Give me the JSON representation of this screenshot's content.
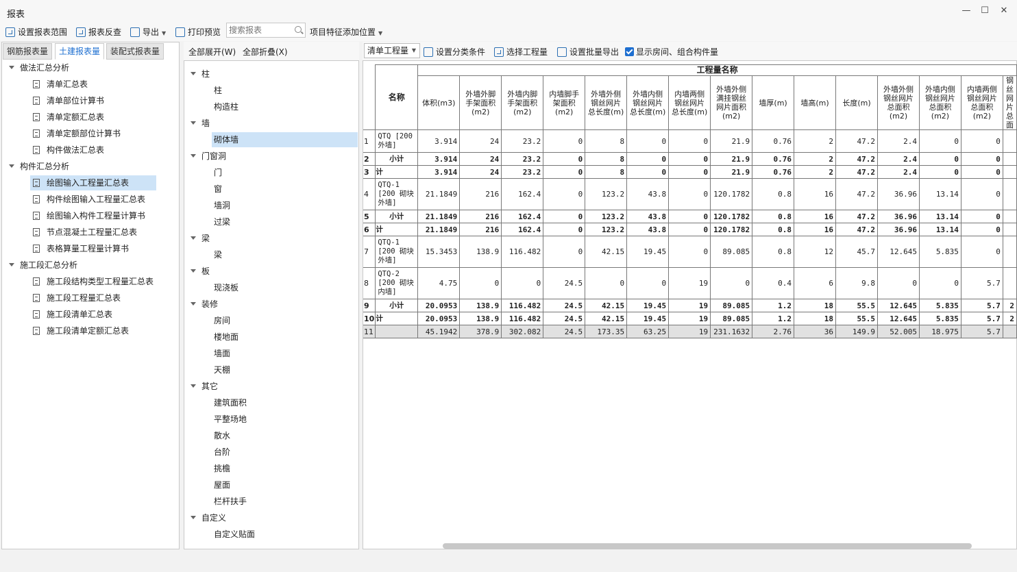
{
  "window": {
    "title": "报表",
    "minimize": "—",
    "maximize": "☐",
    "close": "✕"
  },
  "toolbar": {
    "set_range": "设置报表范围",
    "reverse_check": "报表反查",
    "export": "导出",
    "print_preview": "打印预览",
    "search_placeholder": "搜索报表",
    "feature_position": "项目特征添加位置"
  },
  "left_tabs": [
    "钢筋报表量",
    "土建报表量",
    "装配式报表量"
  ],
  "left_tree": [
    {
      "label": "做法汇总分析",
      "children": [
        "清单汇总表",
        "清单部位计算书",
        "清单定额汇总表",
        "清单定额部位计算书",
        "构件做法汇总表"
      ]
    },
    {
      "label": "构件汇总分析",
      "children": [
        "绘图输入工程量汇总表",
        "构件绘图输入工程量汇总表",
        "绘图输入构件工程量计算书",
        "节点混凝土工程量汇总表",
        "表格算量工程量计算书"
      ]
    },
    {
      "label": "施工段汇总分析",
      "children": [
        "施工段结构类型工程量汇总表",
        "施工段工程量汇总表",
        "施工段清单汇总表",
        "施工段清单定额汇总表"
      ]
    }
  ],
  "mid_toolbar": {
    "expand_all": "全部展开(W)",
    "collapse_all": "全部折叠(X)"
  },
  "mid_tree": [
    {
      "label": "柱",
      "children": [
        "柱",
        "构造柱"
      ]
    },
    {
      "label": "墙",
      "children": [
        "砌体墙"
      ]
    },
    {
      "label": "门窗洞",
      "children": [
        "门",
        "窗",
        "墙洞",
        "过梁"
      ]
    },
    {
      "label": "梁",
      "children": [
        "梁"
      ]
    },
    {
      "label": "板",
      "children": [
        "现浇板"
      ]
    },
    {
      "label": "装修",
      "children": [
        "房间",
        "楼地面",
        "墙面",
        "天棚"
      ]
    },
    {
      "label": "其它",
      "children": [
        "建筑面积",
        "平整场地",
        "散水",
        "台阶",
        "挑檐",
        "屋面",
        "栏杆扶手"
      ]
    },
    {
      "label": "自定义",
      "children": [
        "自定义贴面"
      ]
    }
  ],
  "right_toolbar": {
    "dropdown": "清单工程量",
    "set_category": "设置分类条件",
    "select_qty": "选择工程量",
    "batch_export": "设置批量导出",
    "show_rooms": "显示房间、组合构件量"
  },
  "table": {
    "group_header": "工程量名称",
    "name_header": "名称",
    "columns": [
      "体积(m3)",
      "外墙外脚手架面积(m2)",
      "外墙内脚手架面积(m2)",
      "内墙脚手架面积(m2)",
      "外墙外侧钢丝网片总长度(m)",
      "外墙内侧钢丝网片总长度(m)",
      "内墙两侧钢丝网片总长度(m)",
      "外墙外侧满挂钢丝网片面积(m2)",
      "墙厚(m)",
      "墙高(m)",
      "长度(m)",
      "外墙外侧钢丝网片总面积(m2)",
      "外墙内侧钢丝网片总面积(m2)",
      "内墙两侧钢丝网片总面积(m2)",
      "钢丝网片总面"
    ],
    "rows": [
      {
        "no": "1",
        "name": "QTQ [200 外墙]",
        "type": "item",
        "values": [
          "3.914",
          "24",
          "23.2",
          "0",
          "8",
          "0",
          "0",
          "21.9",
          "0.76",
          "2",
          "47.2",
          "2.4",
          "0",
          "0",
          ""
        ]
      },
      {
        "no": "2",
        "name": "小计",
        "type": "bold",
        "values": [
          "3.914",
          "24",
          "23.2",
          "0",
          "8",
          "0",
          "0",
          "21.9",
          "0.76",
          "2",
          "47.2",
          "2.4",
          "0",
          "0",
          ""
        ]
      },
      {
        "no": "3",
        "name": "计",
        "type": "bold",
        "values": [
          "3.914",
          "24",
          "23.2",
          "0",
          "8",
          "0",
          "0",
          "21.9",
          "0.76",
          "2",
          "47.2",
          "2.4",
          "0",
          "0",
          ""
        ]
      },
      {
        "no": "4",
        "name": "QTQ-1 [200 砌块 外墙]",
        "type": "item",
        "values": [
          "21.1849",
          "216",
          "162.4",
          "0",
          "123.2",
          "43.8",
          "0",
          "120.1782",
          "0.8",
          "16",
          "47.2",
          "36.96",
          "13.14",
          "0",
          ""
        ]
      },
      {
        "no": "5",
        "name": "小计",
        "type": "bold",
        "values": [
          "21.1849",
          "216",
          "162.4",
          "0",
          "123.2",
          "43.8",
          "0",
          "120.1782",
          "0.8",
          "16",
          "47.2",
          "36.96",
          "13.14",
          "0",
          ""
        ]
      },
      {
        "no": "6",
        "name": "计",
        "type": "bold",
        "values": [
          "21.1849",
          "216",
          "162.4",
          "0",
          "123.2",
          "43.8",
          "0",
          "120.1782",
          "0.8",
          "16",
          "47.2",
          "36.96",
          "13.14",
          "0",
          ""
        ]
      },
      {
        "no": "7",
        "name": "QTQ-1 [200 砌块 外墙]",
        "type": "item",
        "values": [
          "15.3453",
          "138.9",
          "116.482",
          "0",
          "42.15",
          "19.45",
          "0",
          "89.085",
          "0.8",
          "12",
          "45.7",
          "12.645",
          "5.835",
          "0",
          ""
        ]
      },
      {
        "no": "8",
        "name": "QTQ-2 [200 砌块 内墙]",
        "type": "item",
        "values": [
          "4.75",
          "0",
          "0",
          "24.5",
          "0",
          "0",
          "19",
          "0",
          "0.4",
          "6",
          "9.8",
          "0",
          "0",
          "5.7",
          ""
        ]
      },
      {
        "no": "9",
        "name": "小计",
        "type": "bold",
        "values": [
          "20.0953",
          "138.9",
          "116.482",
          "24.5",
          "42.15",
          "19.45",
          "19",
          "89.085",
          "1.2",
          "18",
          "55.5",
          "12.645",
          "5.835",
          "5.7",
          "2"
        ]
      },
      {
        "no": "10",
        "name": "计",
        "type": "bold",
        "values": [
          "20.0953",
          "138.9",
          "116.482",
          "24.5",
          "42.15",
          "19.45",
          "19",
          "89.085",
          "1.2",
          "18",
          "55.5",
          "12.645",
          "5.835",
          "5.7",
          "2"
        ]
      },
      {
        "no": "11",
        "name": "",
        "type": "total",
        "values": [
          "45.1942",
          "378.9",
          "302.082",
          "24.5",
          "173.35",
          "63.25",
          "19",
          "231.1632",
          "2.76",
          "36",
          "149.9",
          "52.005",
          "18.975",
          "5.7",
          ""
        ]
      }
    ]
  },
  "colors": {
    "accent": "#1e6fd0",
    "selection": "#cde3f7",
    "total_row": "#e1e1e1"
  }
}
